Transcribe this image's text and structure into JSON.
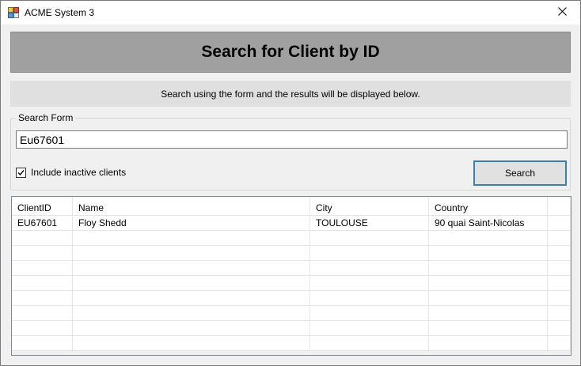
{
  "window": {
    "title": "ACME System 3",
    "icon": "app-icon",
    "close_icon": "close-icon"
  },
  "header": {
    "title": "Search for Client by ID"
  },
  "info": {
    "text": "Search using the form and the results will be displayed below."
  },
  "search_form": {
    "legend": "Search Form",
    "input_value": "Eu67601",
    "include_inactive_label": "Include inactive clients",
    "include_inactive_checked": true,
    "search_button_label": "Search"
  },
  "results": {
    "columns": [
      "ClientID",
      "Name",
      "City",
      "Country"
    ],
    "rows": [
      [
        "EU67601",
        "Floy Shedd",
        "TOULOUSE",
        "90 quai Saint-Nicolas"
      ]
    ]
  },
  "colors": {
    "header_band": "#a0a0a0",
    "info_band": "#e0e0e0",
    "button_border": "#3c7fb1"
  }
}
